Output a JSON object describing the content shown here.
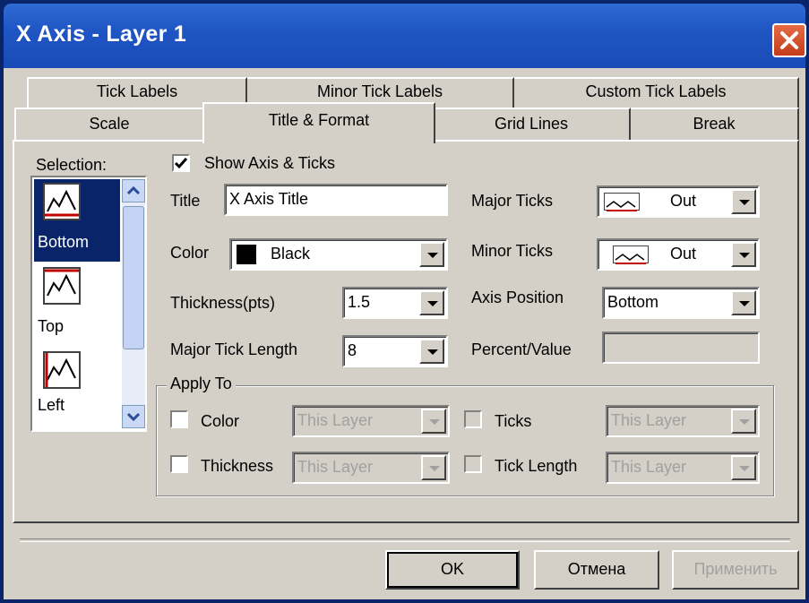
{
  "window": {
    "title": "X Axis - Layer 1"
  },
  "tabs_back": [
    {
      "label": "Tick Labels"
    },
    {
      "label": "Minor Tick Labels"
    },
    {
      "label": "Custom Tick Labels"
    }
  ],
  "tabs_front": [
    {
      "label": "Scale"
    },
    {
      "label": "Title & Format"
    },
    {
      "label": "Grid Lines"
    },
    {
      "label": "Break"
    }
  ],
  "active_tab": "Title & Format",
  "selection": {
    "label": "Selection:",
    "items": [
      {
        "label": "Bottom",
        "icon": "axis-bottom-icon",
        "selected": true
      },
      {
        "label": "Top",
        "icon": "axis-top-icon",
        "selected": false
      },
      {
        "label": "Left",
        "icon": "axis-left-icon",
        "selected": false
      }
    ]
  },
  "show_axis": {
    "label": "Show Axis & Ticks",
    "checked": true
  },
  "title_field": {
    "label": "Title",
    "value": "X Axis Title"
  },
  "color_field": {
    "label": "Color",
    "value": "Black",
    "swatch": "#000000"
  },
  "thickness_field": {
    "label": "Thickness(pts)",
    "value": "1.5"
  },
  "major_tick_length": {
    "label": "Major Tick Length",
    "value": "8"
  },
  "major_ticks": {
    "label": "Major Ticks",
    "value": "Out"
  },
  "minor_ticks": {
    "label": "Minor Ticks",
    "value": "Out"
  },
  "axis_position": {
    "label": "Axis Position",
    "value": "Bottom"
  },
  "percent_value": {
    "label": "Percent/Value",
    "value": ""
  },
  "apply_to": {
    "title": "Apply To",
    "color": {
      "label": "Color",
      "value": "This Layer"
    },
    "thickness": {
      "label": "Thickness",
      "value": "This Layer"
    },
    "ticks": {
      "label": "Ticks",
      "value": "This Layer"
    },
    "tick_length": {
      "label": "Tick Length",
      "value": "This Layer"
    }
  },
  "buttons": {
    "ok": "OK",
    "cancel": "Отмена",
    "apply": "Применить"
  },
  "colors": {
    "titlebar": "#1f56c4",
    "dialog_bg": "#d4d0c8",
    "selection_bg": "#0a246a"
  }
}
